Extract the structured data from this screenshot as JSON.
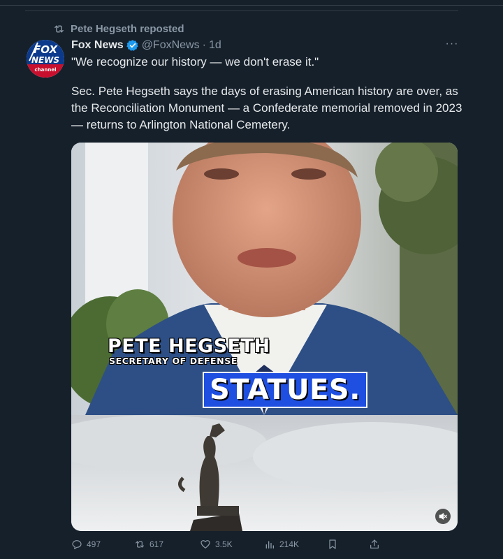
{
  "repost": {
    "icon": "repost-icon",
    "text": "Pete Hegseth reposted"
  },
  "author": {
    "avatar_icon": "fox-news-logo",
    "name": "Fox News",
    "verified_icon": "verified-badge-icon",
    "handle": "@FoxNews",
    "separator": "·",
    "time": "1d"
  },
  "more_icon": "more-options-icon",
  "more_label": "···",
  "tweet": {
    "paragraphs": [
      "\"We recognize our history — we don't erase it.\"",
      "Sec. Pete Hegseth says the days of erasing American history are over, as the Reconciliation Monument — a Confederate memorial removed in 2023 — returns to Arlington National Cemetery."
    ]
  },
  "media": {
    "chyron_name": "PETE HEGSETH",
    "chyron_title": "SECRETARY OF DEFENSE",
    "caption": "STATUES.",
    "mute_icon": "muted-speaker-icon"
  },
  "actions": [
    {
      "icon": "reply-icon",
      "count": "497"
    },
    {
      "icon": "repost-icon",
      "count": "617"
    },
    {
      "icon": "like-icon",
      "count": "3.5K"
    },
    {
      "icon": "views-icon",
      "count": "214K"
    },
    {
      "icon": "bookmark-icon",
      "count": ""
    },
    {
      "icon": "share-icon",
      "count": ""
    }
  ],
  "colors": {
    "background": "#15202b",
    "muted_text": "#8b98a5",
    "primary_text": "#e7e9ea",
    "verified": "#1d9bf0",
    "caption_bg": "#1f4fe0"
  }
}
